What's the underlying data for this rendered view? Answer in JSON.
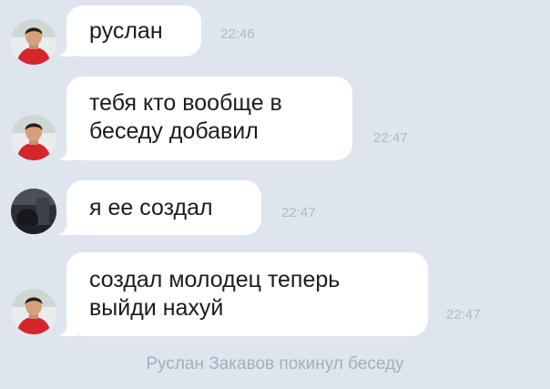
{
  "messages": [
    {
      "text": "руслан",
      "time": "22:46",
      "avatar": "boy-in-red-shirt-avatar"
    },
    {
      "text": "тебя кто вообще в\nбеседу добавил",
      "time": "22:47",
      "avatar": "boy-in-red-shirt-avatar"
    },
    {
      "text": "я ее создал",
      "time": "22:47",
      "avatar": "dark-photo-avatar"
    },
    {
      "text": "создал молодец теперь\nвыйди нахуй",
      "time": "22:47",
      "avatar": "boy-in-red-shirt-avatar"
    }
  ],
  "system_notice": "Руслан Закавов покинул беседу",
  "colors": {
    "background": "#dfe5ef",
    "bubble": "#ffffff",
    "text": "#1c1c1c",
    "time": "#b3b9c3",
    "system": "#a7aebb"
  }
}
